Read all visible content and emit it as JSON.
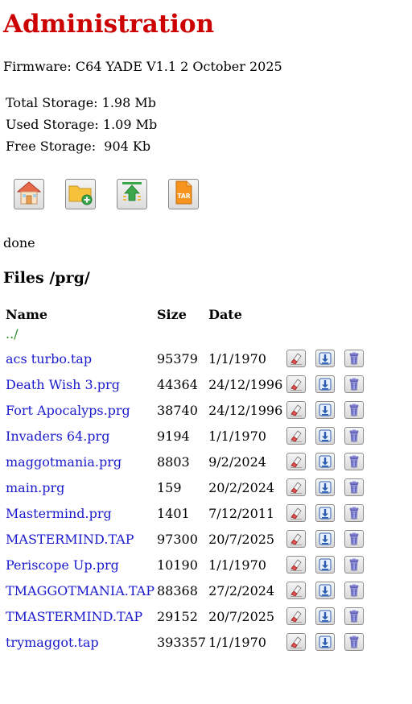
{
  "page": {
    "title": "Administration",
    "firmware": "Firmware: C64 YADE V1.1 2 October 2025"
  },
  "storage": {
    "total": "Total Storage: 1.98 Mb",
    "used": "Used Storage: 1.09 Mb",
    "free": "Free Storage:  904 Kb"
  },
  "toolbar": {
    "buttons": [
      {
        "name": "home",
        "icon": "home-icon"
      },
      {
        "name": "new-folder",
        "icon": "folder-add-icon"
      },
      {
        "name": "upload",
        "icon": "upload-icon"
      },
      {
        "name": "tar",
        "icon": "tar-archive-icon",
        "icon_text": "TAR"
      }
    ]
  },
  "status": "done",
  "files": {
    "heading_label": "Files",
    "path": "/prg/",
    "columns": {
      "name": "Name",
      "size": "Size",
      "date": "Date"
    },
    "parent_link": "../",
    "rows": [
      {
        "name": "acs turbo.tap",
        "size": "95379",
        "date": "1/1/1970"
      },
      {
        "name": "Death Wish 3.prg",
        "size": "44364",
        "date": "24/12/1996"
      },
      {
        "name": "Fort Apocalyps.prg",
        "size": "38740",
        "date": "24/12/1996"
      },
      {
        "name": "Invaders 64.prg",
        "size": "9194",
        "date": "1/1/1970"
      },
      {
        "name": "maggotmania.prg",
        "size": "8803",
        "date": "9/2/2024"
      },
      {
        "name": "main.prg",
        "size": "159",
        "date": "20/2/2024"
      },
      {
        "name": "Mastermind.prg",
        "size": "1401",
        "date": "7/12/2011"
      },
      {
        "name": "MASTERMIND.TAP",
        "size": "97300",
        "date": "20/7/2025"
      },
      {
        "name": "Periscope Up.prg",
        "size": "10190",
        "date": "1/1/1970"
      },
      {
        "name": "TMAGGOTMANIA.TAP",
        "size": "88368",
        "date": "27/2/2024"
      },
      {
        "name": "TMASTERMIND.TAP",
        "size": "29152",
        "date": "20/7/2025"
      },
      {
        "name": "trymaggot.tap",
        "size": "393357",
        "date": "1/1/1970"
      }
    ],
    "actions": [
      {
        "name": "rename",
        "icon": "eraser-icon"
      },
      {
        "name": "download",
        "icon": "download-icon"
      },
      {
        "name": "delete",
        "icon": "trash-icon"
      }
    ]
  },
  "colors": {
    "title": "#cc0000",
    "file_link": "#1a1acc",
    "parent_link": "#228b22"
  }
}
